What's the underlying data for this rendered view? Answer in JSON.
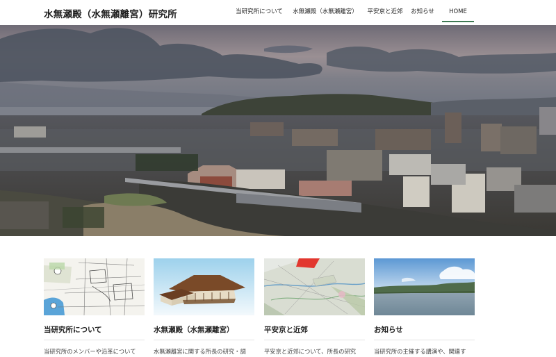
{
  "site": {
    "title": "水無瀬殿（水無瀬離宮）研究所"
  },
  "nav": [
    {
      "label": "当研究所について"
    },
    {
      "label": "水無瀬殿（水無瀬離宮）"
    },
    {
      "label": "平安京と近郊"
    },
    {
      "label": "お知らせ"
    },
    {
      "label": "HOME",
      "active": true
    }
  ],
  "colors": {
    "accent": "#3f7a54",
    "sky_dusk": "#8a7f86",
    "cloud": "#4d5663"
  },
  "cards": [
    {
      "title": "当研究所について",
      "text": "当研究所のメンバーや沿革について",
      "icon": "archaeological-map-image"
    },
    {
      "title": "水無瀬殿（水無瀬離宮）",
      "text": "水無瀬離宮に関する所長の研究・調",
      "icon": "palace-model-image"
    },
    {
      "title": "平安京と近郊",
      "text": "平安京と近郊について、所長の研究",
      "icon": "topographic-map-image"
    },
    {
      "title": "お知らせ",
      "text": "当研究所の主催する講演や、関連す",
      "icon": "river-landscape-image"
    }
  ]
}
